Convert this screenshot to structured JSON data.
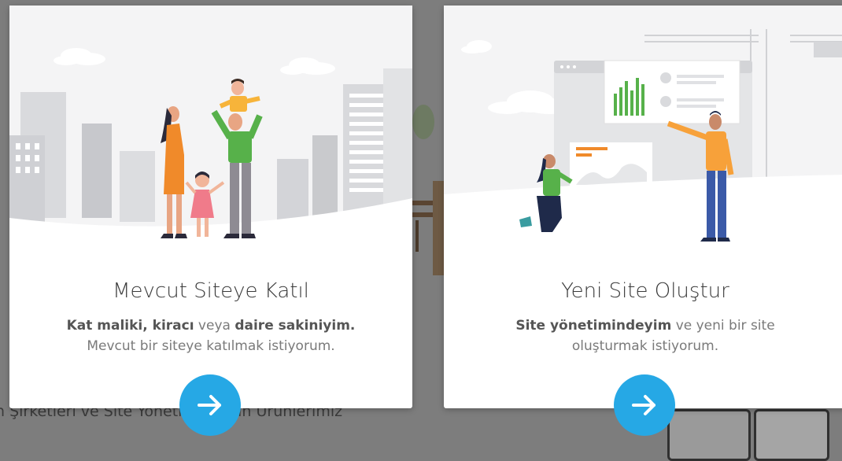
{
  "background": {
    "text": "n Şirketleri ve Site Yönetimleri İçin Ürünlerimiz"
  },
  "cards": [
    {
      "title": "Mevcut Siteye Katıl",
      "desc_bold1": "Kat maliki, kiracı",
      "desc_text1": " veya ",
      "desc_bold2": "daire sakiniyim.",
      "desc_line2": "Mevcut bir siteye katılmak istiyorum.",
      "arrow_icon": "arrow-right-icon"
    },
    {
      "title": "Yeni Site Oluştur",
      "desc_bold1": "Site yönetimindeyim",
      "desc_text1": " ve yeni bir site",
      "desc_line2": "oluşturmak istiyorum.",
      "arrow_icon": "arrow-right-icon"
    }
  ],
  "colors": {
    "accent": "#26a8e5",
    "overlay": "#7d7d7d"
  }
}
